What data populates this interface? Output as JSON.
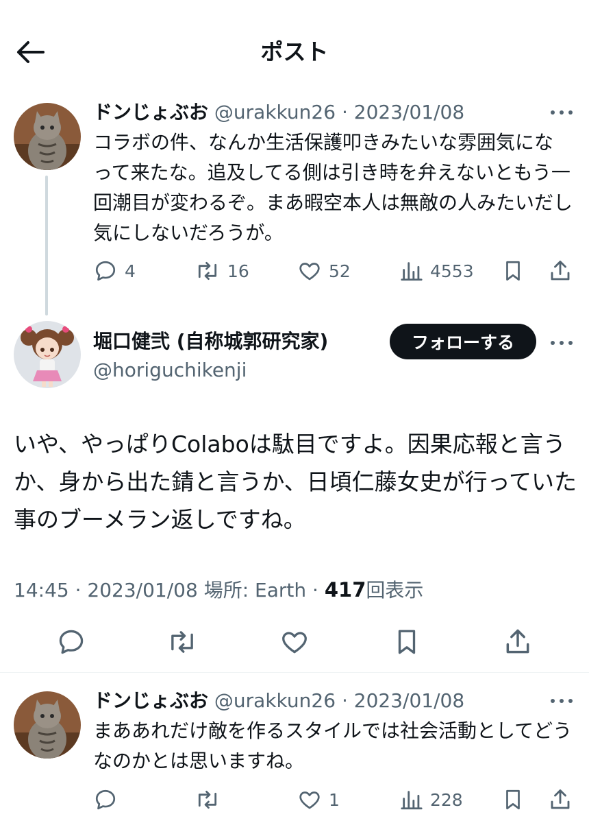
{
  "header": {
    "title": "ポスト"
  },
  "parent_tweet": {
    "display_name": "ドンじょぶお",
    "handle": "@urakkun26",
    "date": "2023/01/08",
    "text": "コラボの件、なんか生活保護叩きみたいな雰囲気になって来たな。追及してる側は引き時を弁えないともう一回潮目が変わるぞ。まあ暇空本人は無敵の人みたいだし気にしないだろうが。",
    "replies": "4",
    "reposts": "16",
    "likes": "52",
    "views": "4553"
  },
  "main_tweet": {
    "display_name": "堀口健弐 (自称城郭研究家)",
    "handle": "@horiguchikenji",
    "follow_label": "フォローする",
    "text": "いや、やっぱりColaboは駄目ですよ。因果応報と言うか、身から出た錆と言うか、日頃仁藤女史が行っていた事のブーメラン返しですね。",
    "time": "14:45",
    "date": "2023/01/08",
    "location_label": "場所: Earth",
    "views_count": "417",
    "views_label": "回表示"
  },
  "reply_tweet": {
    "display_name": "ドンじょぶお",
    "handle": "@urakkun26",
    "date": "2023/01/08",
    "text": "まああれだけ敵を作るスタイルでは社会活動としてどうなのかとは思いますね。",
    "likes": "1",
    "views": "228"
  },
  "separator": "·",
  "colors": {
    "text": "#0f1419",
    "muted": "#536471",
    "thread_line": "#cfd9de",
    "follow_bg": "#0f1419"
  },
  "icons": [
    "back-arrow-icon",
    "more-icon",
    "reply-icon",
    "repost-icon",
    "like-icon",
    "views-icon",
    "bookmark-icon",
    "share-icon"
  ]
}
